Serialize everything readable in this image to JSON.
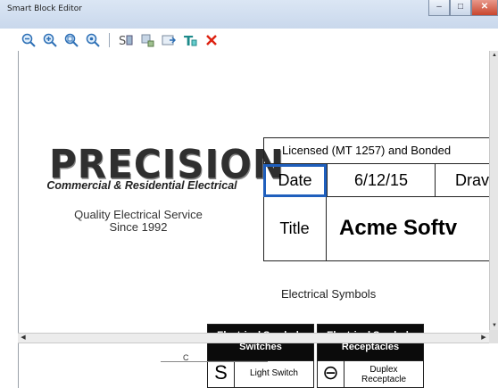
{
  "window": {
    "title": "Smart Block Editor",
    "minimize": "‒",
    "maximize": "□",
    "close": "✕"
  },
  "toolbar": {
    "items": [
      {
        "icon": "zoom-out-icon"
      },
      {
        "icon": "zoom-in-icon"
      },
      {
        "icon": "zoom-window-icon"
      },
      {
        "icon": "zoom-extents-icon"
      },
      {
        "icon": "symbol-properties-icon"
      },
      {
        "icon": "add-component-icon"
      },
      {
        "icon": "insert-block-icon"
      },
      {
        "icon": "add-text-icon"
      },
      {
        "icon": "delete-icon"
      }
    ]
  },
  "logo": {
    "word": "PRECISION",
    "tagline": "Commercial & Residential Electrical",
    "quality_line1": "Quality Electrical Service",
    "quality_line2": "Since 1992"
  },
  "title_block": {
    "licensed": "Licensed (MT 1257) and Bonded",
    "date_label": "Date",
    "date_value": "6/12/15",
    "drawn_label": "Drav",
    "title_label": "Title",
    "title_value": "Acme Softv"
  },
  "section_label": "Electrical Symbols",
  "legends": [
    {
      "header_line1": "Electrical Symbols",
      "header_line2": "Switches",
      "symbol": "S",
      "item": "Light Switch"
    },
    {
      "header_line1": "Electrical Symbols",
      "header_line2": "Receptacles",
      "symbol": "⊖",
      "item_line1": "Duplex",
      "item_line2": "Receptacle"
    }
  ],
  "bottom_fragment": "C"
}
